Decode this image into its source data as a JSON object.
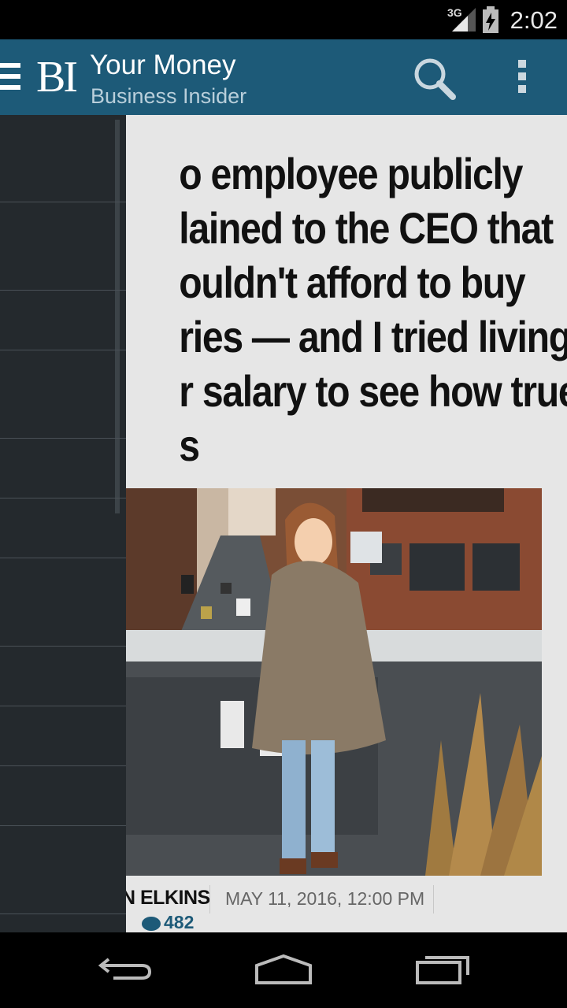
{
  "status_bar": {
    "network": "3G",
    "time": "2:02",
    "signal_icon": "signal-icon",
    "battery_icon": "battery-icon"
  },
  "app_bar": {
    "logo": "BI",
    "title": "Your Money",
    "subtitle": "Business Insider",
    "icons": [
      "hamburger-menu-icon",
      "search-icon",
      "overflow-menu-icon"
    ],
    "background": "#1d5a78"
  },
  "article": {
    "headline_lines": [
      "o employee publicly",
      "lained to the CEO that",
      "ouldn't afford to buy",
      "ries — and I tried living",
      "r salary to see how true",
      "s"
    ],
    "author": "N ELKINS",
    "date": "MAY 11, 2016, 12:00 PM",
    "comments_count": "482",
    "accent": "#1d5a78"
  },
  "drawer": {
    "background": "#24292d"
  },
  "nav_bar": {
    "icons": [
      "back-icon",
      "home-icon",
      "recent-apps-icon"
    ]
  }
}
